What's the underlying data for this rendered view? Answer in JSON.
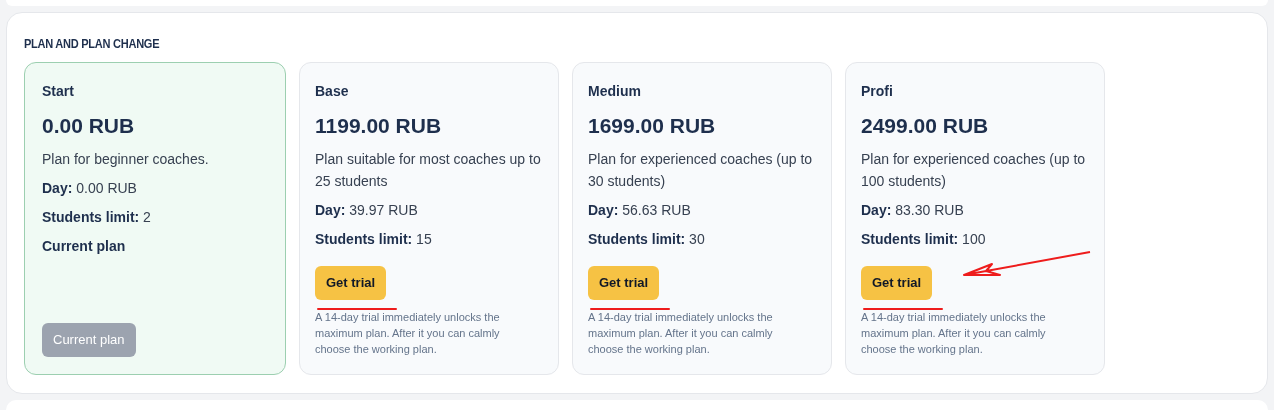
{
  "section_title": "PLAN AND PLAN CHANGE",
  "plans": [
    {
      "kind": "current",
      "name": "Start",
      "price": "0.00 RUB",
      "description": "Plan for beginner coaches.",
      "day_label": "Day:",
      "day_value": "0.00 RUB",
      "limit_label": "Students limit:",
      "limit_value": "2",
      "status": "Current plan",
      "button": "Current plan",
      "disabled": true
    },
    {
      "kind": "trial",
      "name": "Base",
      "price": "1199.00 RUB",
      "description": "Plan suitable for most coaches up to 25 students",
      "day_label": "Day:",
      "day_value": "39.97 RUB",
      "limit_label": "Students limit:",
      "limit_value": "15",
      "button": "Get trial",
      "disabled": false,
      "note": "A 14-day trial immediately unlocks the maximum plan. After it you can calmly choose the working plan.",
      "underlined": true,
      "arrow": false
    },
    {
      "kind": "trial",
      "name": "Medium",
      "price": "1699.00 RUB",
      "description": "Plan for experienced coaches (up to 30 students)",
      "day_label": "Day:",
      "day_value": "56.63 RUB",
      "limit_label": "Students limit:",
      "limit_value": "30",
      "button": "Get trial",
      "disabled": false,
      "note": "A 14-day trial immediately unlocks the maximum plan. After it you can calmly choose the working plan.",
      "underlined": true,
      "arrow": false
    },
    {
      "kind": "trial",
      "name": "Profi",
      "price": "2499.00 RUB",
      "description": "Plan for experienced coaches (up to 100 students)",
      "day_label": "Day:",
      "day_value": "83.30 RUB",
      "limit_label": "Students limit:",
      "limit_value": "100",
      "button": "Get trial",
      "disabled": false,
      "note": "A 14-day trial immediately unlocks the maximum plan. After it you can calmly choose the working plan.",
      "underlined": true,
      "arrow": true
    }
  ]
}
